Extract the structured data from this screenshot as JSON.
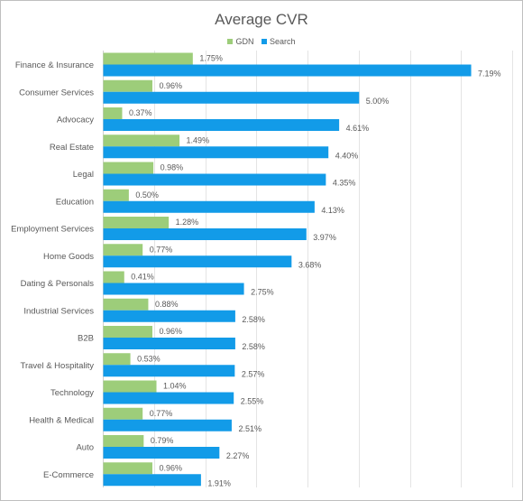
{
  "chart_data": {
    "type": "bar",
    "orientation": "horizontal",
    "title": "Average CVR",
    "xlabel": "",
    "ylabel": "",
    "xlim": [
      0,
      8
    ],
    "grid": true,
    "legend_position": "top",
    "value_format": "percent-2dp",
    "categories": [
      "Finance & Insurance",
      "Consumer Services",
      "Advocacy",
      "Real Estate",
      "Legal",
      "Education",
      "Employment Services",
      "Home Goods",
      "Dating & Personals",
      "Industrial Services",
      "B2B",
      "Travel & Hospitality",
      "Technology",
      "Health & Medical",
      "Auto",
      "E-Commerce"
    ],
    "series": [
      {
        "name": "GDN",
        "color": "#9dcd7a",
        "values": [
          1.75,
          0.96,
          0.37,
          1.49,
          0.98,
          0.5,
          1.28,
          0.77,
          0.41,
          0.88,
          0.96,
          0.53,
          1.04,
          0.77,
          0.79,
          0.96
        ],
        "labels": [
          "1.75%",
          "0.96%",
          "0.37%",
          "1.49%",
          "0.98%",
          "0.50%",
          "1.28%",
          "0.77%",
          "0.41%",
          "0.88%",
          "0.96%",
          "0.53%",
          "1.04%",
          "0.77%",
          "0.79%",
          "0.96%"
        ]
      },
      {
        "name": "Search",
        "color": "#129be8",
        "values": [
          7.19,
          5.0,
          4.61,
          4.4,
          4.35,
          4.13,
          3.97,
          3.68,
          2.75,
          2.58,
          2.58,
          2.57,
          2.55,
          2.51,
          2.27,
          1.91
        ],
        "labels": [
          "7.19%",
          "5.00%",
          "4.61%",
          "4.40%",
          "4.35%",
          "4.13%",
          "3.97%",
          "3.68%",
          "2.75%",
          "2.58%",
          "2.58%",
          "2.57%",
          "2.55%",
          "2.51%",
          "2.27%",
          "1.91%"
        ]
      }
    ]
  }
}
